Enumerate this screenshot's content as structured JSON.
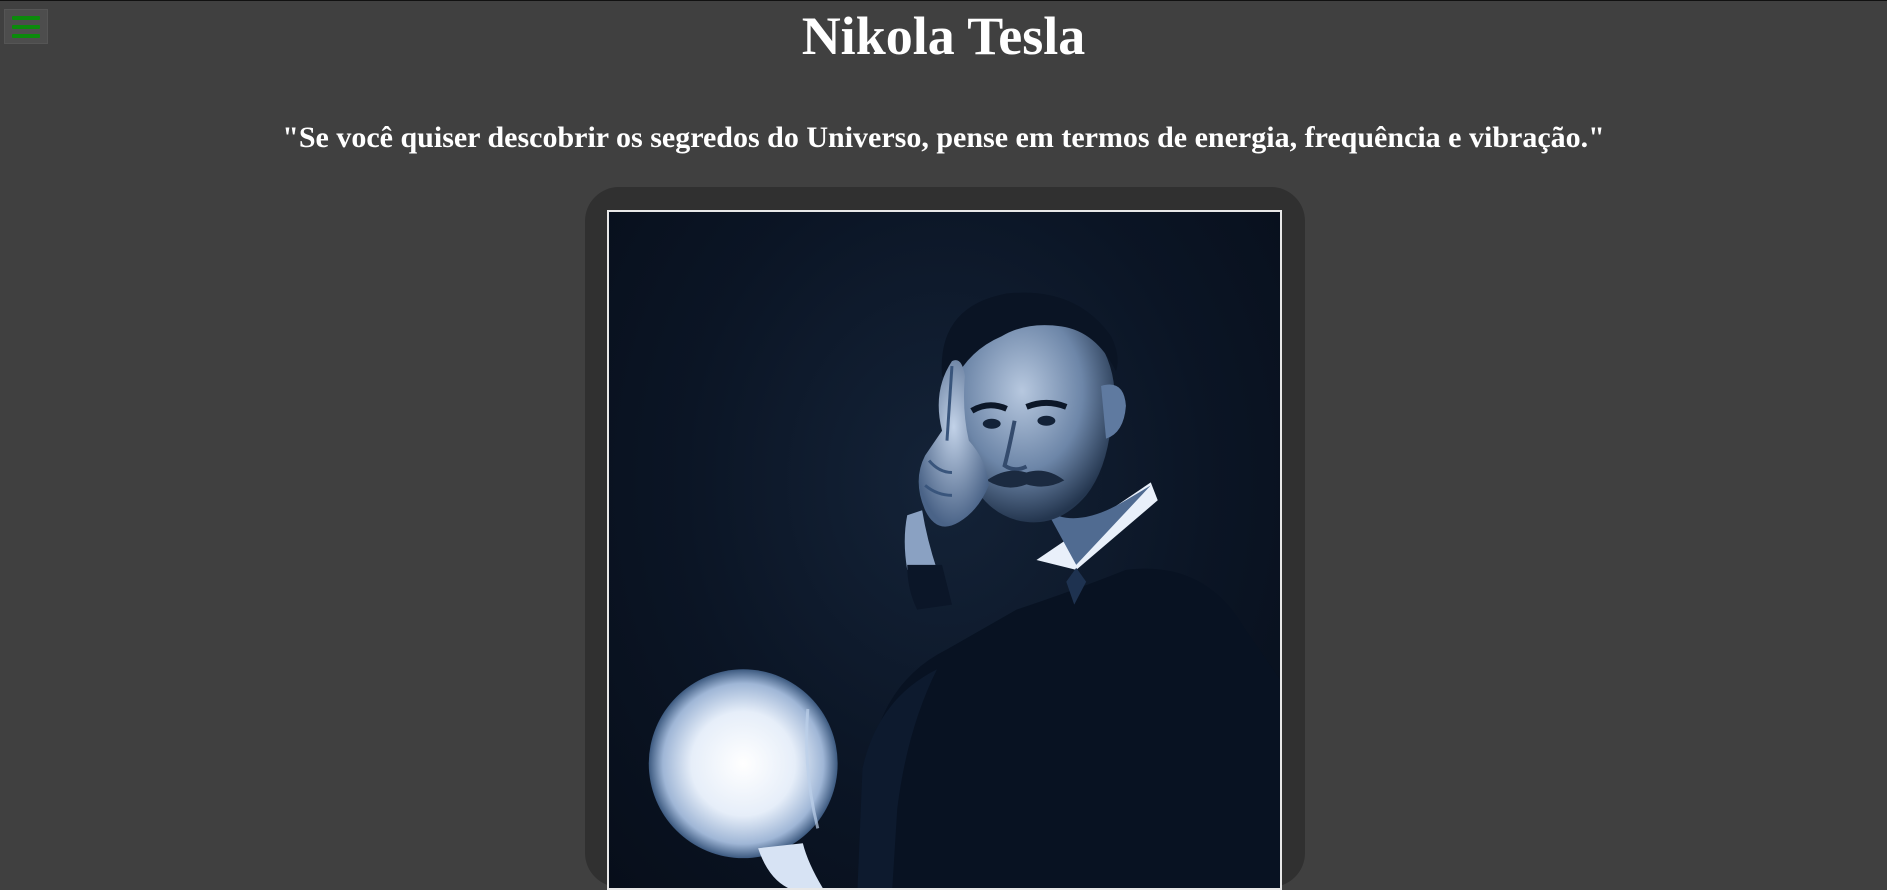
{
  "header": {
    "menu_icon": "hamburger-menu-icon",
    "menu_icon_color": "#0b8a0b",
    "title": "Nikola Tesla"
  },
  "main": {
    "quote": "\"Se você quiser descobrir os segredos do Universo, pense em termos de energia, frequência e vibração.\"",
    "photo_subject": "portrait-photo"
  },
  "colors": {
    "background": "#404040",
    "frame": "#303030",
    "text": "#ffffff"
  }
}
